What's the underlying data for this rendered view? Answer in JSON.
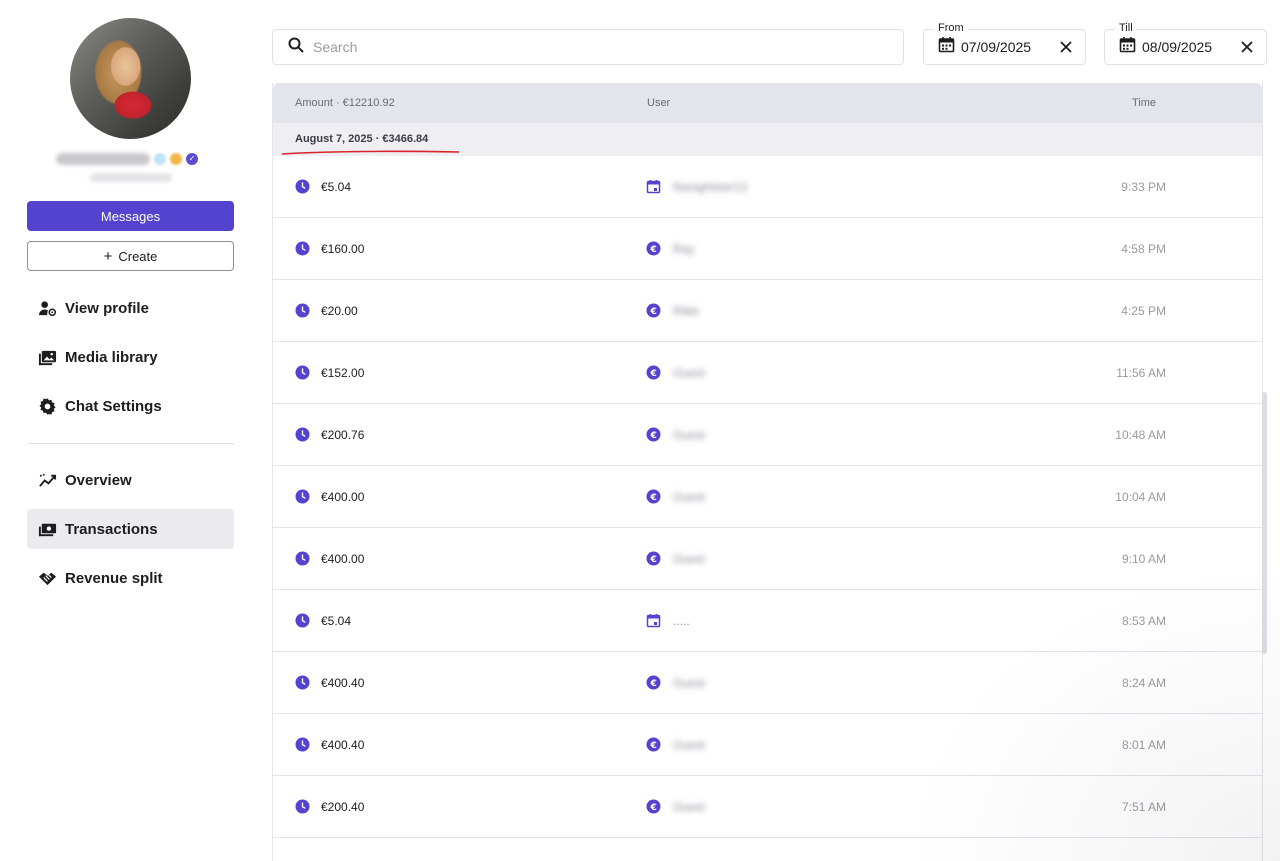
{
  "sidebar": {
    "messages_label": "Messages",
    "create_label": "Create",
    "nav": {
      "view_profile": "View profile",
      "media_library": "Media library",
      "chat_settings": "Chat Settings",
      "overview": "Overview",
      "transactions": "Transactions",
      "revenue_split": "Revenue split"
    },
    "active_item": "Transactions"
  },
  "filters": {
    "search_placeholder": "Search",
    "from_label": "From",
    "from_value": "07/09/2025",
    "till_label": "Till",
    "till_value": "08/09/2025"
  },
  "table": {
    "headers": {
      "amount": "Amount · €12210.92",
      "user": "User",
      "time": "Time"
    },
    "group": {
      "label": "August 7, 2025 · €3466.84"
    },
    "rows": [
      {
        "amount": "€5.04",
        "user_icon": "calendar-icon",
        "user": "Nanightster12",
        "blurred": true,
        "time": "9:33 PM"
      },
      {
        "amount": "€160.00",
        "user_icon": "euro-icon",
        "user": "Ray",
        "blurred": true,
        "time": "4:58 PM"
      },
      {
        "amount": "€20.00",
        "user_icon": "euro-icon",
        "user": "Rikki",
        "blurred": true,
        "time": "4:25 PM"
      },
      {
        "amount": "€152.00",
        "user_icon": "euro-icon",
        "user": "Guest",
        "blurred": true,
        "time": "11:56 AM"
      },
      {
        "amount": "€200.76",
        "user_icon": "euro-icon",
        "user": "Guest",
        "blurred": true,
        "time": "10:48 AM"
      },
      {
        "amount": "€400.00",
        "user_icon": "euro-icon",
        "user": "Guest",
        "blurred": true,
        "time": "10:04 AM"
      },
      {
        "amount": "€400.00",
        "user_icon": "euro-icon",
        "user": "Guest",
        "blurred": true,
        "time": "9:10 AM"
      },
      {
        "amount": "€5.04",
        "user_icon": "calendar-icon",
        "user": ".....",
        "blurred": false,
        "time": "8:53 AM"
      },
      {
        "amount": "€400.40",
        "user_icon": "euro-icon",
        "user": "Guest",
        "blurred": true,
        "time": "8:24 AM"
      },
      {
        "amount": "€400.40",
        "user_icon": "euro-icon",
        "user": "Guest",
        "blurred": true,
        "time": "8:01 AM"
      },
      {
        "amount": "€200.40",
        "user_icon": "euro-icon",
        "user": "Guest",
        "blurred": true,
        "time": "7:51 AM"
      }
    ]
  },
  "colors": {
    "accent": "#5443cf",
    "annotation_underline": "#d8252b"
  }
}
